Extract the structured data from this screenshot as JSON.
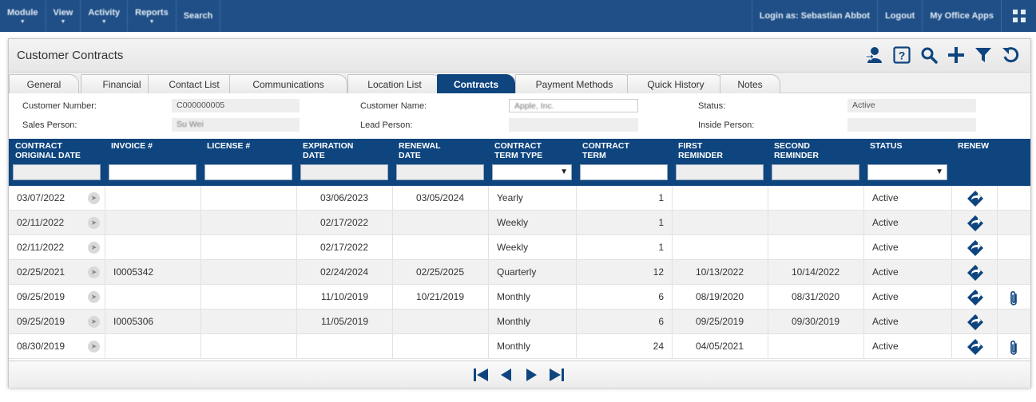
{
  "nav": {
    "left": [
      "Module",
      "View",
      "Activity",
      "Reports",
      "Search"
    ],
    "login": "Login as: Sebastian Abbot",
    "logout": "Logout",
    "my_office_apps": "My Office Apps"
  },
  "panel": {
    "title": "Customer Contracts"
  },
  "tabs": [
    "General",
    "Financial",
    "Contact List",
    "Communications",
    "Location List",
    "Contracts",
    "Payment Methods",
    "Quick History",
    "Notes"
  ],
  "active_tab": "Contracts",
  "info": {
    "customer_number_label": "Customer Number:",
    "customer_number": "C000000005",
    "customer_name_label": "Customer Name:",
    "customer_name": "Apple, Inc.",
    "status_label": "Status:",
    "status": "Active",
    "sales_person_label": "Sales Person:",
    "sales_person": "Su Wei",
    "lead_person_label": "Lead Person:",
    "lead_person": "",
    "inside_person_label": "Inside Person:",
    "inside_person": ""
  },
  "columns": [
    {
      "l1": "CONTRACT",
      "l2": "ORIGINAL DATE"
    },
    {
      "l1": "INVOICE #",
      "l2": ""
    },
    {
      "l1": "LICENSE #",
      "l2": ""
    },
    {
      "l1": "EXPIRATION",
      "l2": "DATE"
    },
    {
      "l1": "RENEWAL",
      "l2": "DATE"
    },
    {
      "l1": "CONTRACT",
      "l2": "TERM TYPE"
    },
    {
      "l1": "CONTRACT",
      "l2": "TERM"
    },
    {
      "l1": "FIRST",
      "l2": "REMINDER"
    },
    {
      "l1": "SECOND",
      "l2": "REMINDER"
    },
    {
      "l1": "STATUS",
      "l2": ""
    },
    {
      "l1": "RENEW",
      "l2": ""
    }
  ],
  "rows": [
    {
      "orig": "03/07/2022",
      "invoice": "",
      "license": "",
      "exp": "03/06/2023",
      "ren": "03/05/2024",
      "type": "Yearly",
      "term": "1",
      "first": "",
      "second": "",
      "status": "Active",
      "clip": false
    },
    {
      "orig": "02/11/2022",
      "invoice": "",
      "license": "",
      "exp": "02/17/2022",
      "ren": "",
      "type": "Weekly",
      "term": "1",
      "first": "",
      "second": "",
      "status": "Active",
      "clip": false
    },
    {
      "orig": "02/11/2022",
      "invoice": "",
      "license": "",
      "exp": "02/17/2022",
      "ren": "",
      "type": "Weekly",
      "term": "1",
      "first": "",
      "second": "",
      "status": "Active",
      "clip": false
    },
    {
      "orig": "02/25/2021",
      "invoice": "I0005342",
      "license": "",
      "exp": "02/24/2024",
      "ren": "02/25/2025",
      "type": "Quarterly",
      "term": "12",
      "first": "10/13/2022",
      "second": "10/14/2022",
      "status": "Active",
      "clip": false
    },
    {
      "orig": "09/25/2019",
      "invoice": "",
      "license": "",
      "exp": "11/10/2019",
      "ren": "10/21/2019",
      "type": "Monthly",
      "term": "6",
      "first": "08/19/2020",
      "second": "08/31/2020",
      "status": "Active",
      "clip": true
    },
    {
      "orig": "09/25/2019",
      "invoice": "I0005306",
      "license": "",
      "exp": "11/05/2019",
      "ren": "",
      "type": "Monthly",
      "term": "6",
      "first": "09/25/2019",
      "second": "09/30/2019",
      "status": "Active",
      "clip": false
    },
    {
      "orig": "08/30/2019",
      "invoice": "",
      "license": "",
      "exp": "",
      "ren": "",
      "type": "Monthly",
      "term": "24",
      "first": "04/05/2021",
      "second": "",
      "status": "Active",
      "clip": true
    }
  ],
  "icons": {
    "toolbar": [
      "assign-user-icon",
      "help-icon",
      "search-icon",
      "add-icon",
      "filter-icon",
      "refresh-icon"
    ],
    "pager": [
      "first-page-icon",
      "previous-page-icon",
      "next-page-icon",
      "last-page-icon"
    ]
  },
  "colors": {
    "primary": "#0e457f",
    "nav": "#1f4f86"
  }
}
